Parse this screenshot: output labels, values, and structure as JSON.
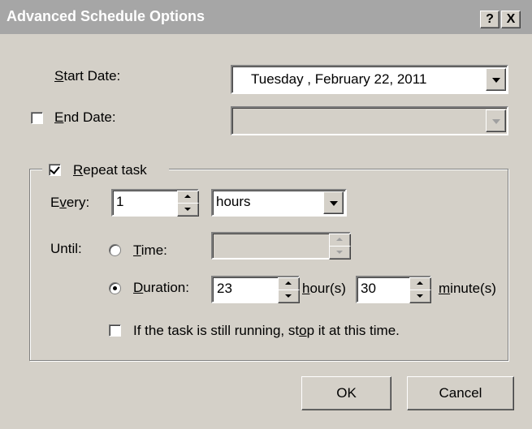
{
  "window": {
    "title": "Advanced Schedule Options",
    "help_glyph": "?",
    "close_glyph": "X"
  },
  "start_date": {
    "label_prefix": "",
    "label_u": "S",
    "label_rest": "tart Date:",
    "value": "Tuesday   ,  February  22, 2011"
  },
  "end_date": {
    "label_u": "E",
    "label_rest": "nd Date:",
    "checked": false,
    "value": ""
  },
  "repeat": {
    "label_u": "R",
    "label_rest": "epeat task",
    "checked": true
  },
  "every": {
    "label_a": "E",
    "label_u": "v",
    "label_rest": "ery:",
    "value": "1",
    "unit": "hours"
  },
  "until": {
    "label": "Until:"
  },
  "time": {
    "label_u": "T",
    "label_rest": "ime:",
    "selected": false,
    "value": ""
  },
  "duration": {
    "label_u": "D",
    "label_rest": "uration:",
    "selected": true,
    "hours": "23",
    "hours_label_u": "h",
    "hours_label_rest": "our(s)",
    "minutes": "30",
    "minutes_label_u": "m",
    "minutes_label_rest": "inute(s)"
  },
  "stop": {
    "label_a": "If the task is still running, st",
    "label_u": "o",
    "label_rest": "p it at this time.",
    "checked": false
  },
  "buttons": {
    "ok": "OK",
    "cancel": "Cancel"
  }
}
